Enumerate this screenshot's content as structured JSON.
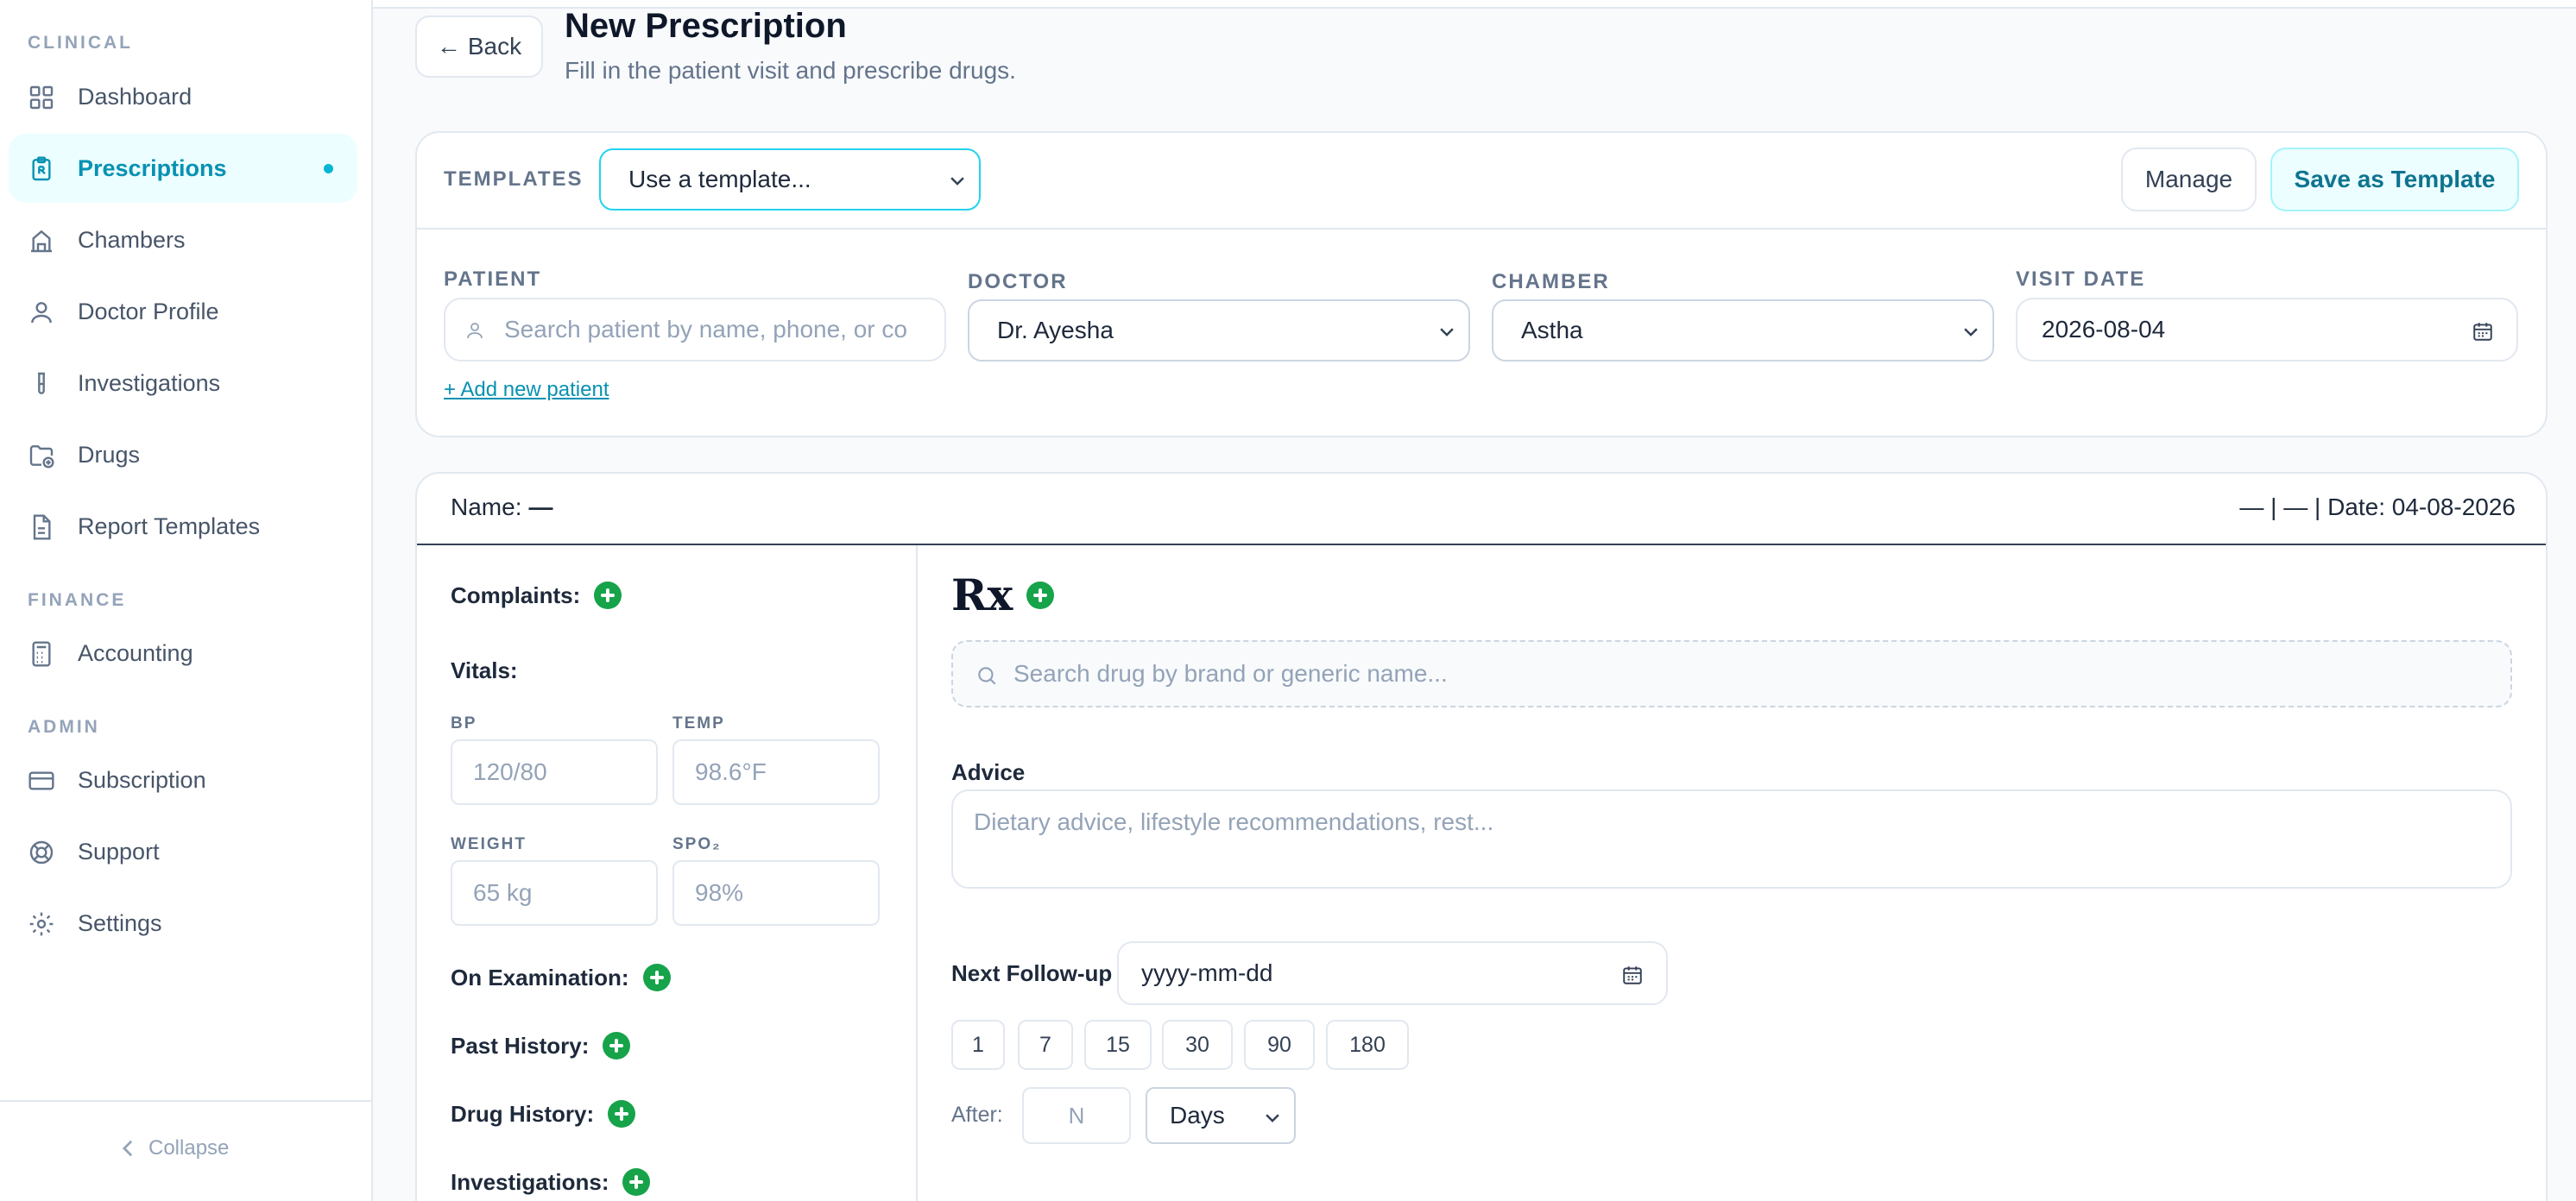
{
  "sidebar": {
    "sections": {
      "clinical": "CLINICAL",
      "finance": "FINANCE",
      "admin": "ADMIN"
    },
    "items": [
      {
        "label": "Dashboard",
        "icon": "dashboard-icon"
      },
      {
        "label": "Prescriptions",
        "icon": "prescription-icon",
        "active": true
      },
      {
        "label": "Chambers",
        "icon": "building-icon"
      },
      {
        "label": "Doctor Profile",
        "icon": "user-icon"
      },
      {
        "label": "Investigations",
        "icon": "test-tube-icon"
      },
      {
        "label": "Drugs",
        "icon": "folder-plus-icon"
      },
      {
        "label": "Report Templates",
        "icon": "document-icon"
      },
      {
        "label": "Accounting",
        "icon": "calculator-icon"
      },
      {
        "label": "Subscription",
        "icon": "credit-card-icon"
      },
      {
        "label": "Support",
        "icon": "lifebuoy-icon"
      },
      {
        "label": "Settings",
        "icon": "gear-icon"
      }
    ],
    "collapse_label": "Collapse"
  },
  "header": {
    "back_label": "Back",
    "title": "New Prescription",
    "subtitle": "Fill in the patient visit and prescribe drugs."
  },
  "templates": {
    "label": "TEMPLATES",
    "select_value": "Use a template...",
    "manage_label": "Manage",
    "save_label": "Save as Template"
  },
  "visit": {
    "patient_label": "PATIENT",
    "patient_placeholder": "Search patient by name, phone, or co",
    "add_patient_label": "+ Add new patient",
    "doctor_label": "DOCTOR",
    "doctor_value": "Dr. Ayesha",
    "chamber_label": "CHAMBER",
    "chamber_value": "Astha",
    "visit_date_label": "VISIT DATE",
    "visit_date_value": "2026-08-04"
  },
  "prescription": {
    "name_label": "Name:",
    "name_value": "—",
    "header_right": "— | — | Date: 04-08-2026",
    "complaints_label": "Complaints:",
    "vitals_label": "Vitals:",
    "vitals": {
      "bp_label": "BP",
      "bp_placeholder": "120/80",
      "temp_label": "TEMP",
      "temp_placeholder": "98.6°F",
      "weight_label": "WEIGHT",
      "weight_placeholder": "65 kg",
      "spo2_label": "SPO₂",
      "spo2_placeholder": "98%"
    },
    "on_exam_label": "On Examination:",
    "past_history_label": "Past History:",
    "drug_history_label": "Drug History:",
    "investigations_label": "Investigations:",
    "rx_label": "Rx",
    "drug_search_placeholder": "Search drug by brand or generic name...",
    "advice_label": "Advice",
    "advice_placeholder": "Dietary advice, lifestyle recommendations, rest...",
    "follow_up_label": "Next Follow-up",
    "follow_up_placeholder": "yyyy-mm-dd",
    "quick_days": [
      "1",
      "7",
      "15",
      "30",
      "90",
      "180"
    ],
    "after_label": "After:",
    "after_placeholder": "N",
    "unit_value": "Days"
  },
  "colors": {
    "accent": "#06b6d4",
    "accent_text": "#0891b2",
    "add_green": "#16a34a"
  }
}
